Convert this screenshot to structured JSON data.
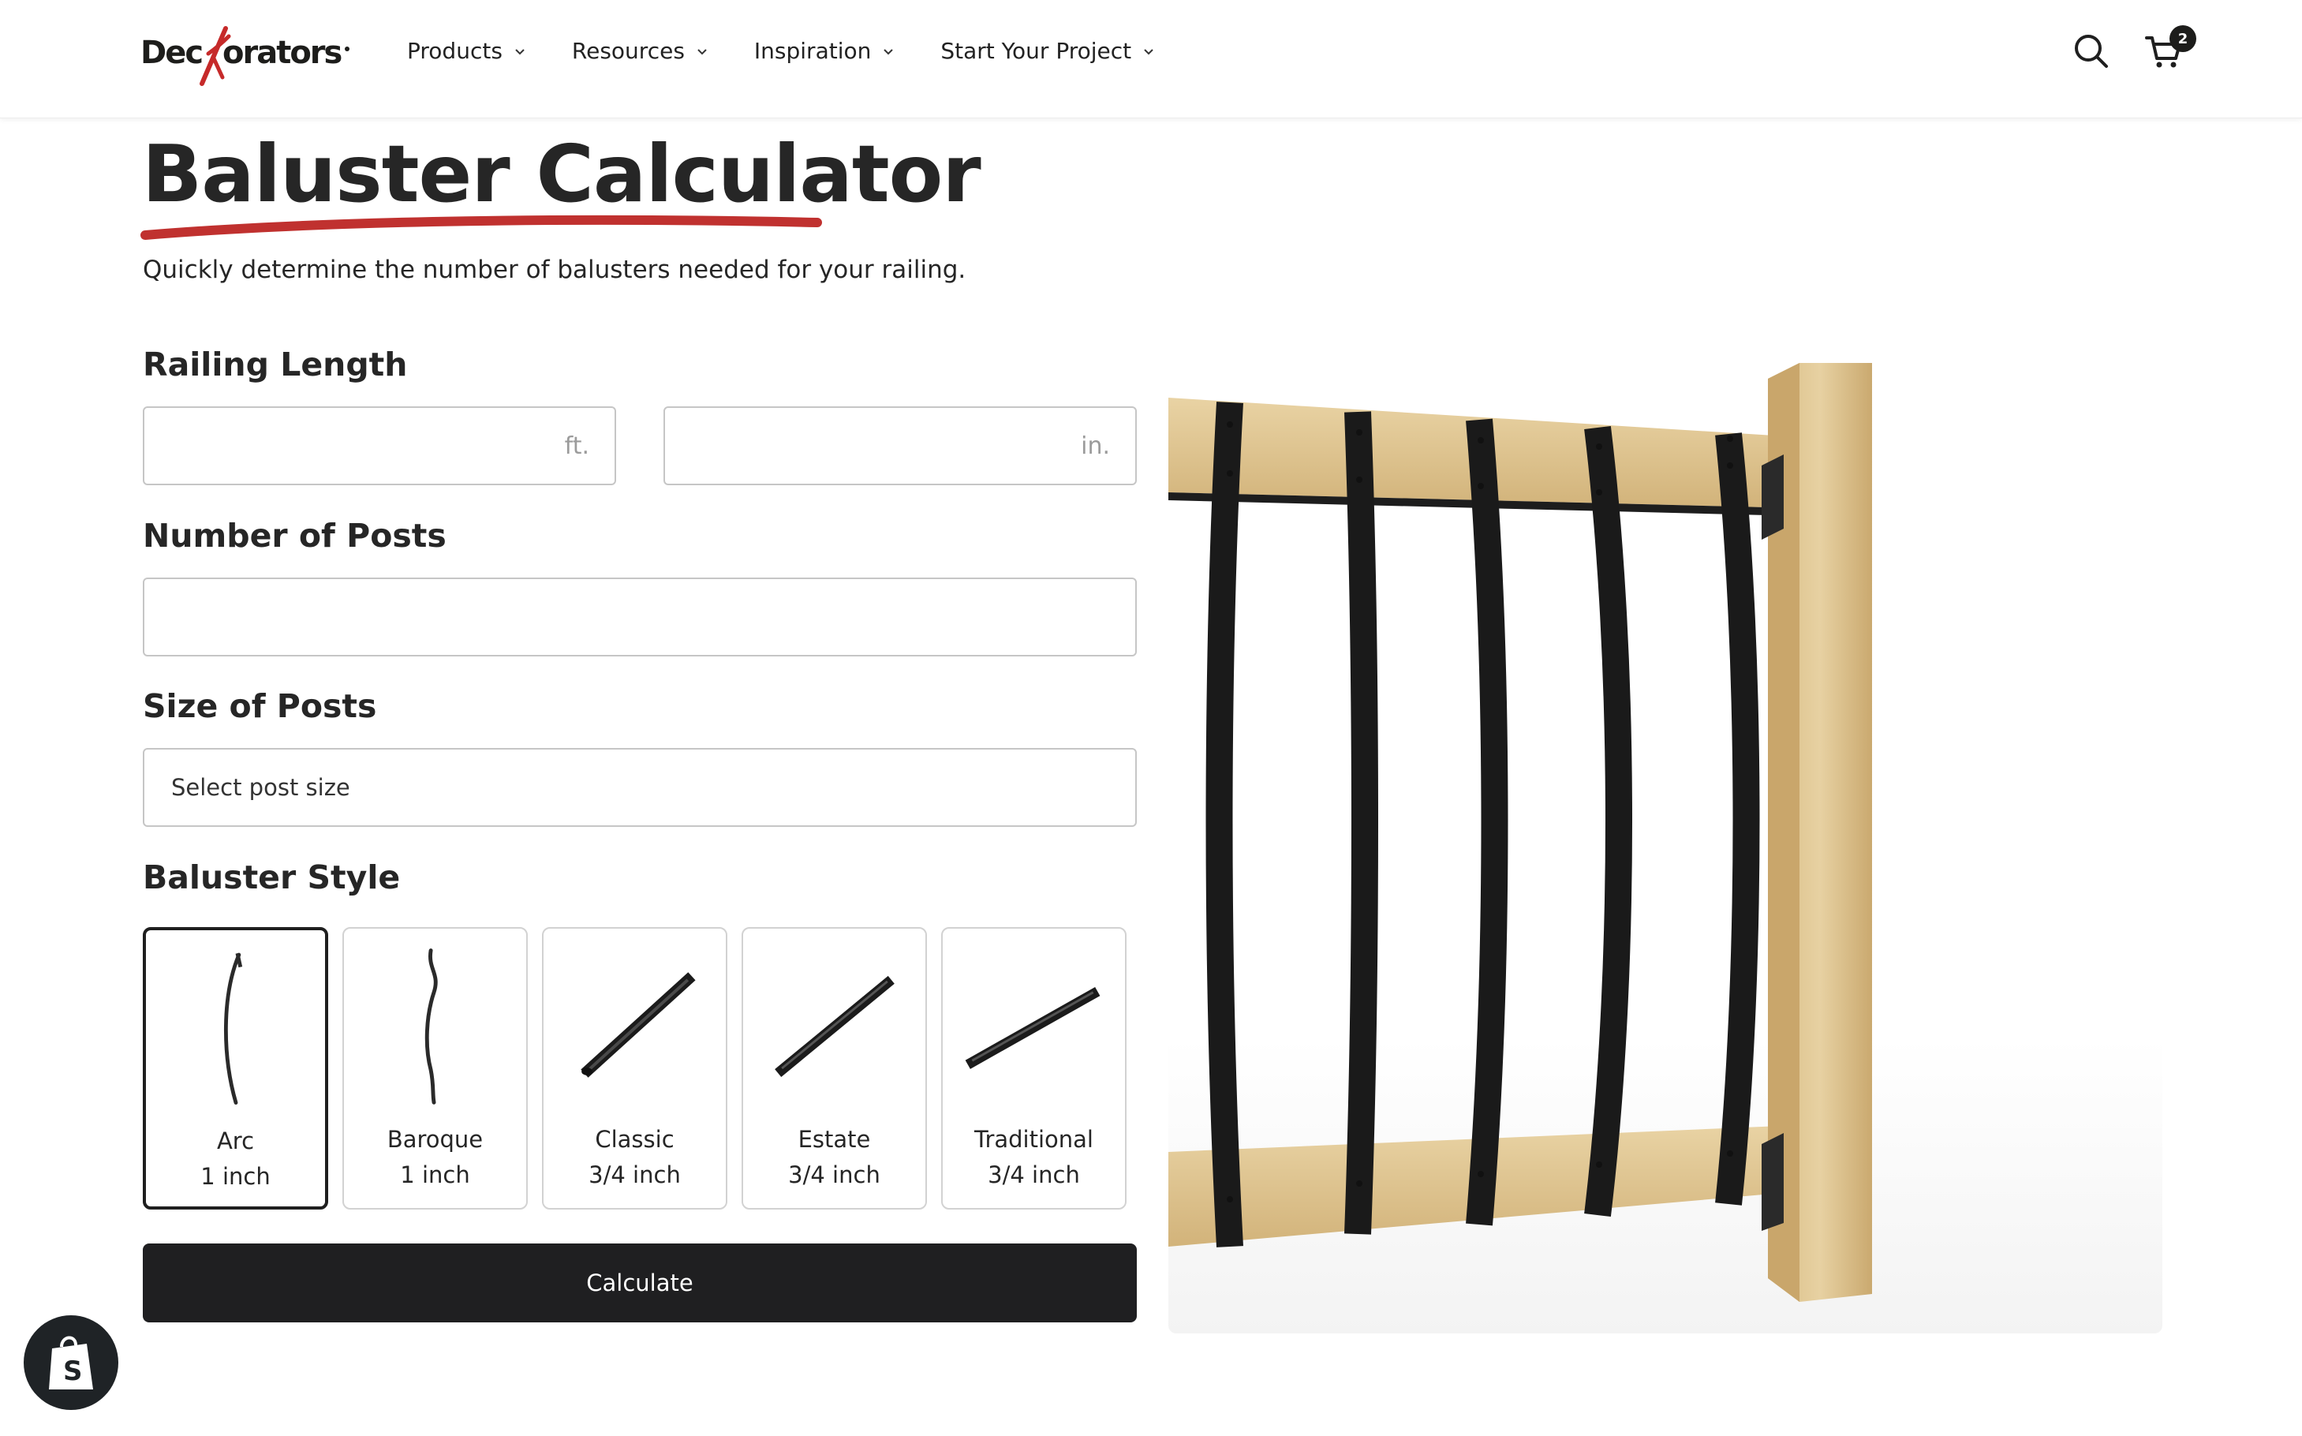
{
  "header": {
    "logo_text": "Deckorators",
    "nav": [
      {
        "label": "Products"
      },
      {
        "label": "Resources"
      },
      {
        "label": "Inspiration"
      },
      {
        "label": "Start Your Project"
      }
    ],
    "cart_count": "2",
    "icons": [
      "search-icon",
      "cart-icon",
      "chevron-down-icon"
    ]
  },
  "page": {
    "title": "Baluster Calculator",
    "subtitle": "Quickly determine the number of balusters needed for your railing.",
    "accent_color": "#c0312f"
  },
  "form": {
    "railing_length_label": "Railing Length",
    "feet_value": "",
    "feet_suffix": "ft.",
    "inches_value": "",
    "inches_suffix": "in.",
    "posts_label": "Number of Posts",
    "posts_value": "",
    "post_size_label": "Size of Posts",
    "post_size_selected": "Select post size",
    "baluster_style_label": "Baluster Style",
    "styles": [
      {
        "name": "Arc",
        "size": "1 inch",
        "selected": true
      },
      {
        "name": "Baroque",
        "size": "1 inch",
        "selected": false
      },
      {
        "name": "Classic",
        "size": "3/4 inch",
        "selected": false
      },
      {
        "name": "Estate",
        "size": "3/4 inch",
        "selected": false
      },
      {
        "name": "Traditional",
        "size": "3/4 inch",
        "selected": false
      }
    ],
    "calculate_label": "Calculate"
  }
}
